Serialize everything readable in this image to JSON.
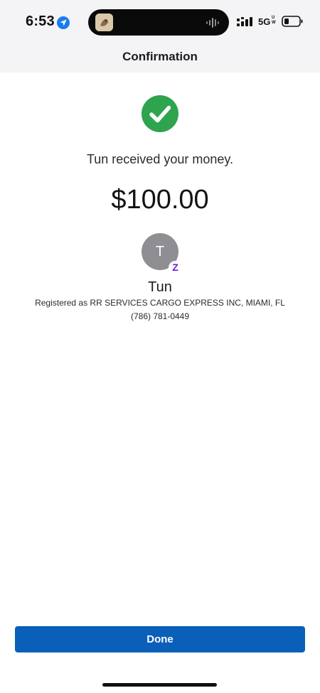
{
  "status_bar": {
    "time": "6:53",
    "network": "5G",
    "network_sub_top": "U",
    "network_sub_bottom": "W",
    "icons": {
      "location": "location-arrow-icon",
      "app": "app-thumbnail-icon",
      "audio": "audio-waveform-icon",
      "signal": "cellular-signal-icon",
      "battery": "battery-icon"
    }
  },
  "header": {
    "title": "Confirmation"
  },
  "confirmation": {
    "message": "Tun received your money.",
    "amount": "$100.00",
    "icon": "check-circle-icon"
  },
  "recipient": {
    "initial": "T",
    "badge": "Z",
    "name": "Tun",
    "registered": "Registered as RR SERVICES CARGO EXPRESS INC, MIAMI, FL",
    "phone": "(786) 781-0449"
  },
  "actions": {
    "done_label": "Done"
  },
  "colors": {
    "success": "#2ea44f",
    "primary_button": "#0a5fb8",
    "avatar": "#8e8e93",
    "zelle": "#6d1ed4",
    "header_bg": "#f4f4f6"
  }
}
